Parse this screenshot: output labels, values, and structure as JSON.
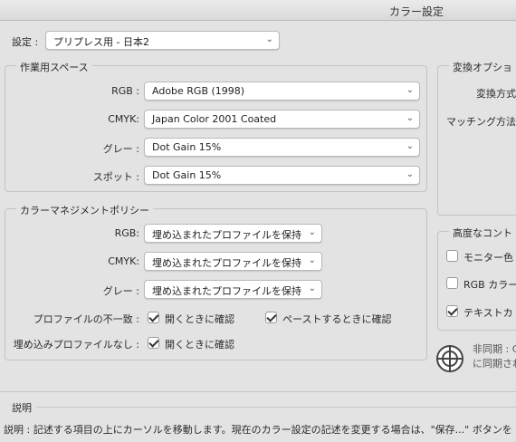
{
  "window": {
    "title": "カラー設定"
  },
  "settings": {
    "label": "設定 :",
    "value": "プリプレス用 - 日本2"
  },
  "working_spaces": {
    "title": "作業用スペース",
    "rows": [
      {
        "label": "RGB :",
        "value": "Adobe RGB (1998)"
      },
      {
        "label": "CMYK:",
        "value": "Japan Color 2001 Coated"
      },
      {
        "label": "グレー :",
        "value": "Dot Gain 15%"
      },
      {
        "label": "スポット :",
        "value": "Dot Gain 15%"
      }
    ]
  },
  "conversion": {
    "title": "変換オプショ",
    "engine_label": "変換方式",
    "intent_label": "マッチング方法"
  },
  "policies": {
    "title": "カラーマネジメントポリシー",
    "rows": [
      {
        "label": "RGB:",
        "value": "埋め込まれたプロファイルを保持"
      },
      {
        "label": "CMYK:",
        "value": "埋め込まれたプロファイルを保持"
      },
      {
        "label": "グレー :",
        "value": "埋め込まれたプロファイルを保持"
      }
    ],
    "mismatch_label": "プロファイルの不一致 :",
    "mismatch_open": {
      "label": "開くときに確認",
      "checked": true
    },
    "mismatch_paste": {
      "label": "ペーストするときに確認",
      "checked": true
    },
    "missing_label": "埋め込みプロファイルなし :",
    "missing_open": {
      "label": "開くときに確認",
      "checked": true
    }
  },
  "advanced": {
    "title": "高度なコント",
    "items": [
      {
        "label": "モニター色",
        "checked": false
      },
      {
        "label": "RGB カラー",
        "checked": false
      },
      {
        "label": "テキストカ",
        "checked": true
      }
    ]
  },
  "sync": {
    "line1": "非同期 : C",
    "line2": "に同期され"
  },
  "description": {
    "title": "説明",
    "text": "説明 : 記述する項目の上にカーソルを移動します。現在のカラー設定の記述を変更する場合は、\"保存...\" ボタンを"
  }
}
